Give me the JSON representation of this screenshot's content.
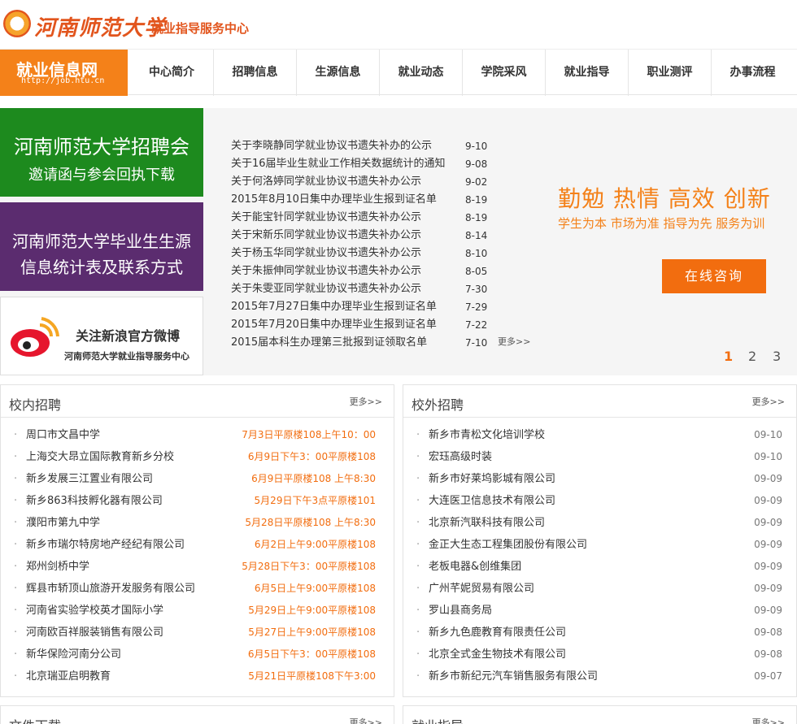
{
  "header": {
    "university": "河南师范大学",
    "center": "就业指导服务中心"
  },
  "nav": {
    "brand": "就业信息网",
    "brand_url": "http://job.htu.cn",
    "items": [
      "中心简介",
      "招聘信息",
      "生源信息",
      "就业动态",
      "学院采风",
      "就业指导",
      "职业测评",
      "办事流程"
    ]
  },
  "promos": {
    "fair_line1": "河南师范大学招聘会",
    "fair_line2": "邀请函与参会回执下载",
    "source_line1": "河南师范大学毕业生生源",
    "source_line2": "信息统计表及联系方式",
    "weibo_line1": "关注新浪官方微博",
    "weibo_line2": "河南师范大学就业指导服务中心"
  },
  "notices": [
    {
      "title": "关于李晓静同学就业协议书遗失补办的公示",
      "date": "9-10"
    },
    {
      "title": "关于16届毕业生就业工作相关数据统计的通知",
      "date": "9-08"
    },
    {
      "title": "关于何洛婷同学就业协议书遗失补办公示",
      "date": "9-02"
    },
    {
      "title": "2015年8月10日集中办理毕业生报到证名单",
      "date": "8-19"
    },
    {
      "title": "关于能宝针同学就业协议书遗失补办公示",
      "date": "8-19"
    },
    {
      "title": "关于宋新乐同学就业协议书遗失补办公示",
      "date": "8-14"
    },
    {
      "title": "关于杨玉华同学就业协议书遗失补办公示",
      "date": "8-10"
    },
    {
      "title": "关于朱振伸同学就业协议书遗失补办公示",
      "date": "8-05"
    },
    {
      "title": "关于朱雯亚同学就业协议书遗失补办公示",
      "date": "7-30"
    },
    {
      "title": "2015年7月27日集中办理毕业生报到证名单",
      "date": "7-29"
    },
    {
      "title": "2015年7月20日集中办理毕业生报到证名单",
      "date": "7-22"
    },
    {
      "title": "2015届本科生办理第三批报到证领取名单",
      "date": "7-10"
    }
  ],
  "notice_more": "更多>>",
  "slogan": {
    "main": "勤勉 热情 高效 创新",
    "sub": "学生为本 市场为准 指导为先 服务为训",
    "consult": "在线咨询"
  },
  "pager": [
    "1",
    "2",
    "3"
  ],
  "campus": {
    "title": "校内招聘",
    "more": "更多>>",
    "rows": [
      {
        "name": "周口市文昌中学",
        "info": "7月3日平原楼108上午10：00"
      },
      {
        "name": "上海交大昂立国际教育新乡分校",
        "info": "6月9日下午3：00平原楼108"
      },
      {
        "name": "新乡发展三江置业有限公司",
        "info": "6月9日平原楼108 上午8:30"
      },
      {
        "name": "新乡863科技孵化器有限公司",
        "info": "5月29日下午3点平原楼101"
      },
      {
        "name": "濮阳市第九中学",
        "info": "5月28日平原楼108 上午8:30"
      },
      {
        "name": "新乡市瑞尔特房地产经纪有限公司",
        "info": "6月2日上午9:00平原楼108"
      },
      {
        "name": "郑州剑桥中学",
        "info": "5月28日下午3：00平原楼108"
      },
      {
        "name": "辉县市轿顶山旅游开发服务有限公司",
        "info": "6月5日上午9:00平原楼108"
      },
      {
        "name": "河南省实验学校英才国际小学",
        "info": "5月29日上午9:00平原楼108"
      },
      {
        "name": "河南欧百祥服装销售有限公司",
        "info": "5月27日上午9:00平原楼108"
      },
      {
        "name": "新华保险河南分公司",
        "info": "6月5日下午3：00平原楼108"
      },
      {
        "name": "北京瑞亚启明教育",
        "info": "5月21日平原楼108下午3:00"
      }
    ]
  },
  "offcampus": {
    "title": "校外招聘",
    "more": "更多>>",
    "rows": [
      {
        "name": "新乡市青松文化培训学校",
        "date": "09-10"
      },
      {
        "name": "宏珏高级时装",
        "date": "09-10"
      },
      {
        "name": "新乡市好莱坞影城有限公司",
        "date": "09-09"
      },
      {
        "name": "大连医卫信息技术有限公司",
        "date": "09-09"
      },
      {
        "name": "北京新汽联科技有限公司",
        "date": "09-09"
      },
      {
        "name": "金正大生态工程集团股份有限公司",
        "date": "09-09"
      },
      {
        "name": "老板电器&创维集团",
        "date": "09-09"
      },
      {
        "name": "广州芊妮贸易有限公司",
        "date": "09-09"
      },
      {
        "name": "罗山县商务局",
        "date": "09-09"
      },
      {
        "name": "新乡九色鹿教育有限责任公司",
        "date": "09-08"
      },
      {
        "name": "北京全式金生物技术有限公司",
        "date": "09-08"
      },
      {
        "name": "新乡市新纪元汽车销售服务有限公司",
        "date": "09-07"
      }
    ]
  },
  "downloads": {
    "title": "文件下载",
    "more": "更多>>"
  },
  "guidance": {
    "title": "就业指导",
    "more": "更多>>"
  },
  "colors": {
    "brand_orange": "#f48119",
    "fair_green": "#1d8a1e",
    "source_purple": "#5b2c6f"
  },
  "icons": [
    "university-seal-icon",
    "weibo-icon"
  ]
}
